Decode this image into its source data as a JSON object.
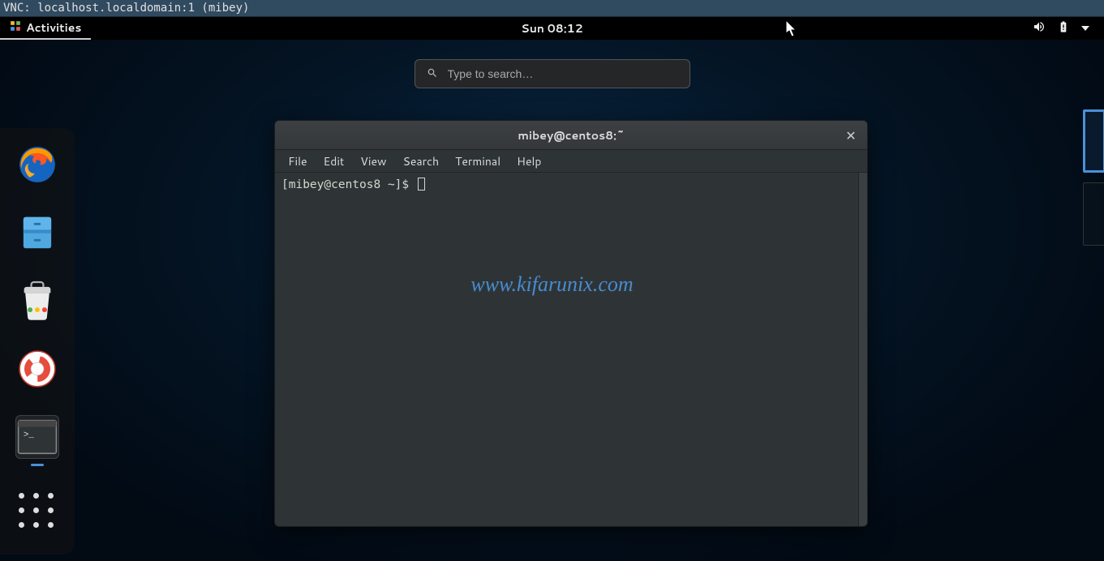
{
  "vnc": {
    "title": "VNC: localhost.localdomain:1 (mibey)"
  },
  "panel": {
    "activities": "Activities",
    "clock": "Sun 08:12"
  },
  "search": {
    "placeholder": "Type to search…"
  },
  "dock": {
    "items": [
      {
        "name": "firefox-icon"
      },
      {
        "name": "files-icon"
      },
      {
        "name": "software-icon"
      },
      {
        "name": "help-icon"
      },
      {
        "name": "terminal-icon",
        "active": true
      }
    ],
    "grid_name": "show-applications-icon"
  },
  "terminal": {
    "title": "mibey@centos8:~",
    "menu": [
      "File",
      "Edit",
      "View",
      "Search",
      "Terminal",
      "Help"
    ],
    "prompt": "[mibey@centos8 ~]$ "
  },
  "watermark": "www.kifarunix.com"
}
